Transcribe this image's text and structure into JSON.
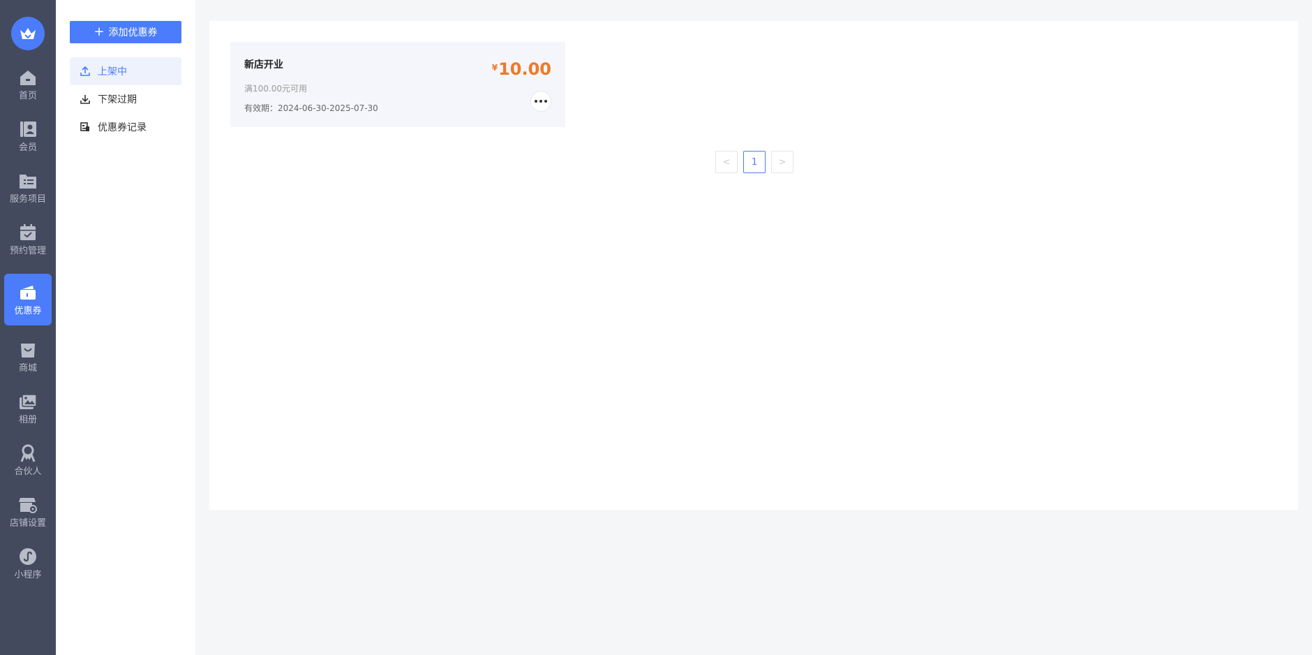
{
  "nav": {
    "items": [
      {
        "label": "首页",
        "icon": "home-icon"
      },
      {
        "label": "会员",
        "icon": "member-icon"
      },
      {
        "label": "服务项目",
        "icon": "service-list-icon"
      },
      {
        "label": "预约管理",
        "icon": "calendar-check-icon"
      },
      {
        "label": "优惠券",
        "icon": "coupon-wallet-icon",
        "active": true
      },
      {
        "label": "商城",
        "icon": "shopping-bag-icon"
      },
      {
        "label": "相册",
        "icon": "photo-album-icon"
      },
      {
        "label": "合伙人",
        "icon": "partner-icon"
      },
      {
        "label": "店铺设置",
        "icon": "store-settings-icon"
      },
      {
        "label": "小程序",
        "icon": "mini-program-icon"
      }
    ]
  },
  "submenu": {
    "add_label": "添加优惠券",
    "items": [
      {
        "label": "上架中",
        "icon": "upload-icon",
        "active": true
      },
      {
        "label": "下架过期",
        "icon": "download-icon"
      },
      {
        "label": "优惠券记录",
        "icon": "record-icon"
      }
    ]
  },
  "coupon": {
    "name": "新店开业",
    "condition": "满100.00元可用",
    "validity": "有效期：2024-06-30-2025-07-30",
    "currency": "¥",
    "amount": "10.00"
  },
  "pagination": {
    "prev": "<",
    "current": "1",
    "next": ">"
  },
  "colors": {
    "primary": "#4a7cfb",
    "price": "#f07828",
    "rail": "#434a5e"
  }
}
